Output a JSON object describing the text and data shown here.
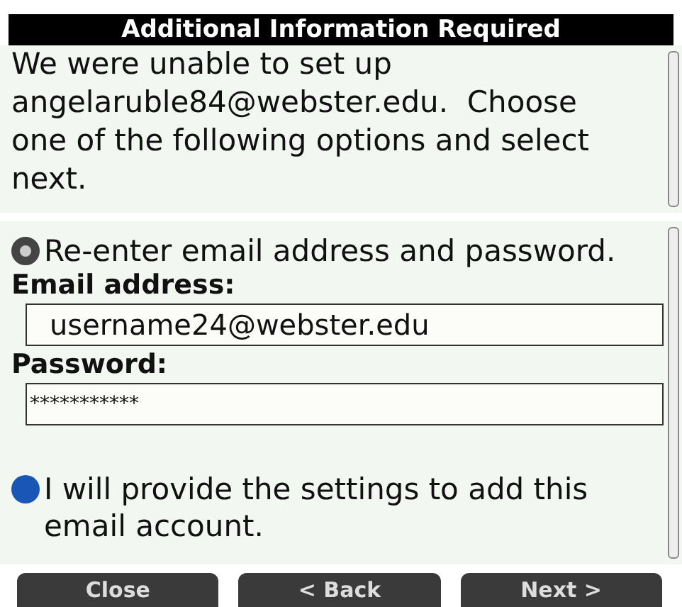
{
  "dialog": {
    "title": "Additional Information Required",
    "message": "We were unable to set up angelaruble84@webster.edu.  Choose one of the following options and select next."
  },
  "options": [
    {
      "kind": "credentials",
      "label": "Re-enter email address and password.",
      "selected": true,
      "email_label": "Email address:",
      "email_value": "username24@webster.edu",
      "password_label": "Password:",
      "password_value": "***********"
    },
    {
      "kind": "manual",
      "label": "I will provide the settings to add this email account.",
      "selected": false
    }
  ],
  "buttons": [
    "Close",
    "< Back",
    "Next >"
  ]
}
